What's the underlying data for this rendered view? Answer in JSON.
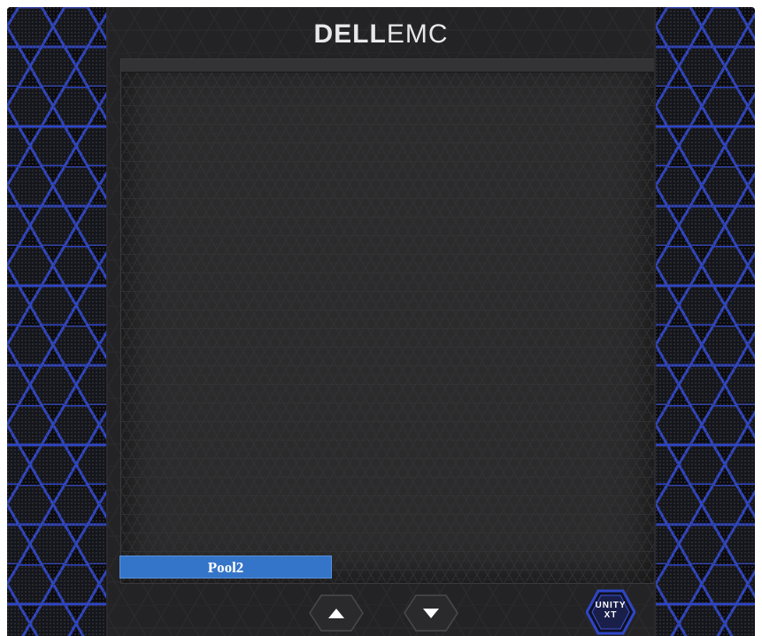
{
  "brand": {
    "dell": "DELL",
    "emc": "EMC"
  },
  "pool": {
    "label": "Pool2"
  },
  "controls": {
    "up_icon": "triangle-up-icon",
    "down_icon": "triangle-down-icon"
  },
  "badge": {
    "line1": "UNITY",
    "line2": "XT"
  },
  "colors": {
    "bezel": "#1b1b1c",
    "accent_blue": "#2f4fd0",
    "pool_bar": "#3575c9"
  }
}
